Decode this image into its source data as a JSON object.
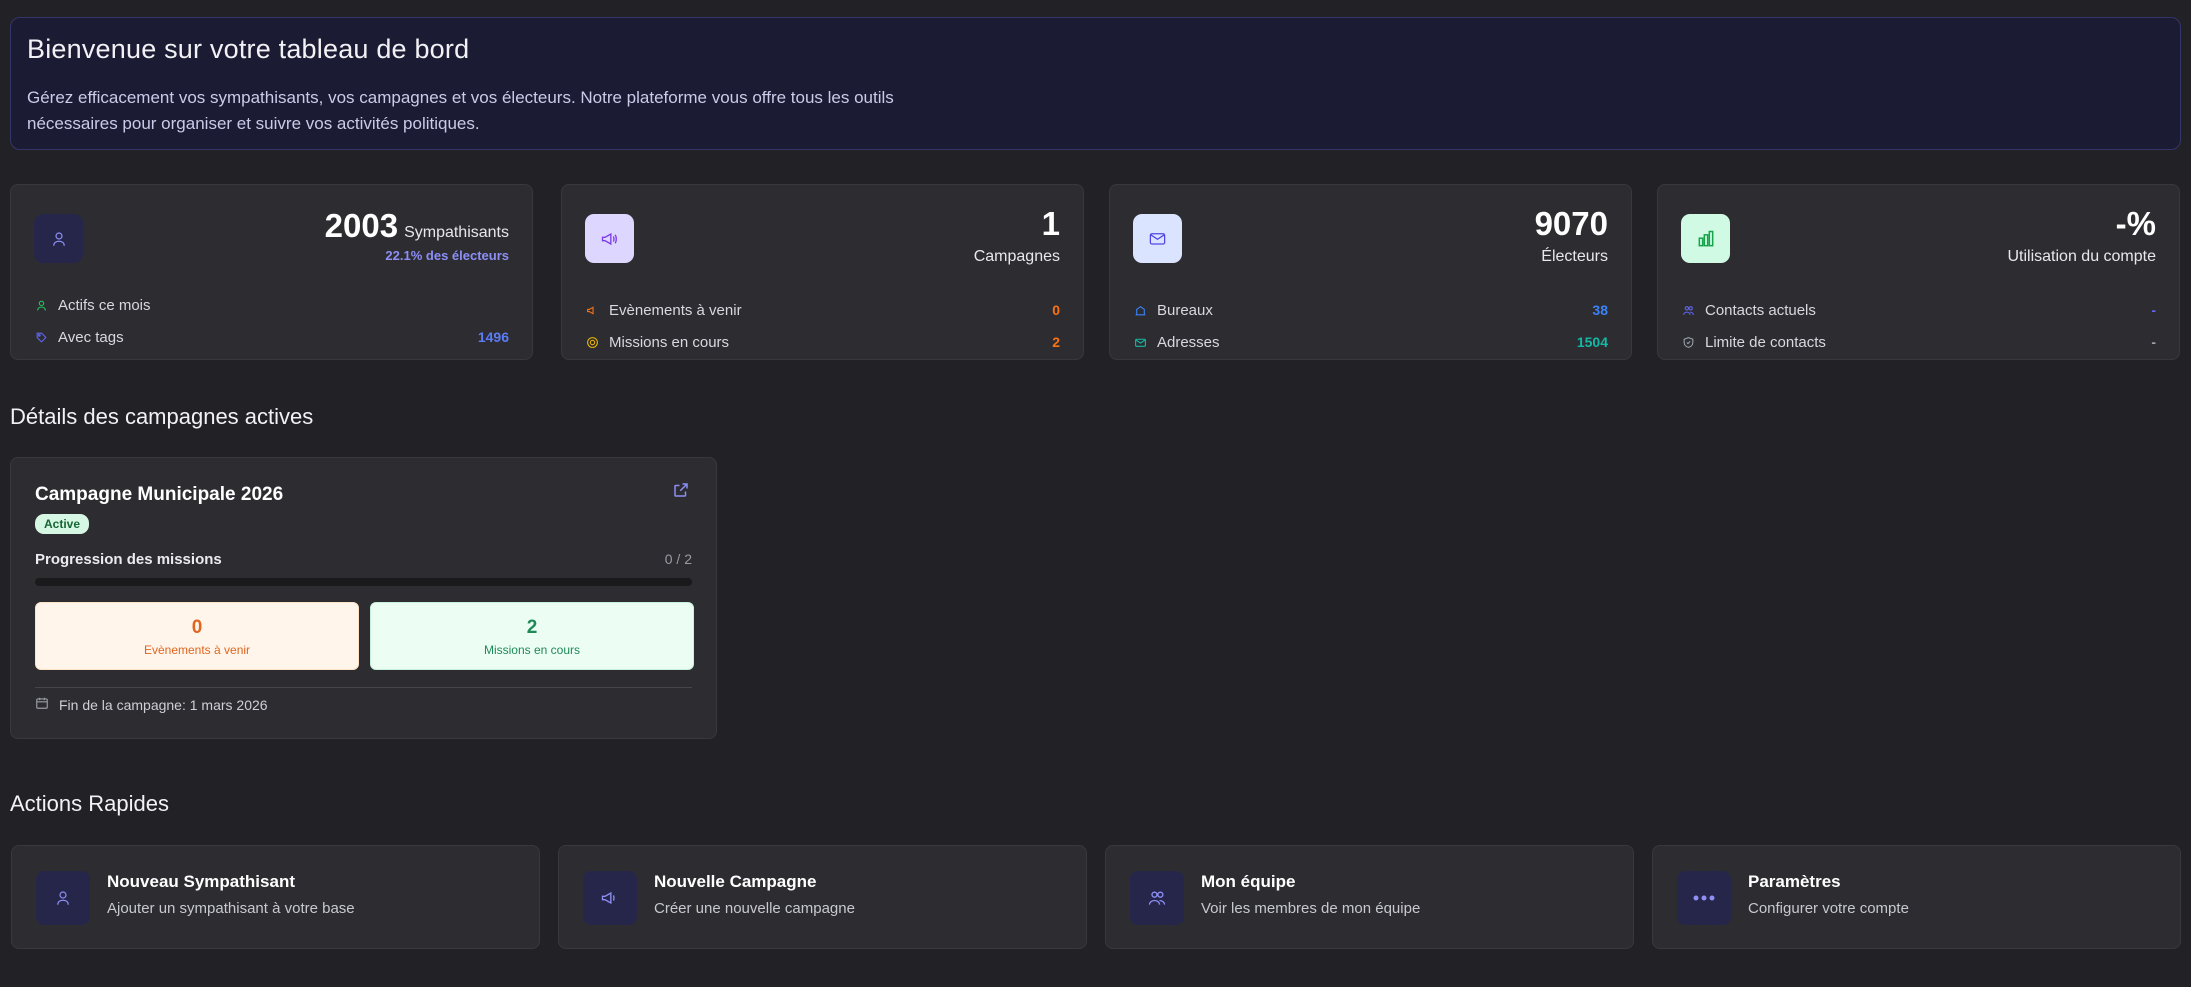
{
  "welcome": {
    "title": "Bienvenue sur votre tableau de bord",
    "text": "Gérez efficacement vos sympathisants, vos campagnes et vos électeurs. Notre plateforme vous offre tous les outils nécessaires pour organiser et suivre vos activités politiques."
  },
  "stats": {
    "sympathisants": {
      "value": "2003",
      "unit": "Sympathisants",
      "percent": "22.1% des électeurs",
      "icon": "user-icon",
      "rows": [
        {
          "label": "Actifs ce mois",
          "value": "",
          "icon": "user-icon"
        },
        {
          "label": "Avec tags",
          "value": "1496",
          "icon": "tag-icon"
        }
      ]
    },
    "campagnes": {
      "value": "1",
      "unit": "Campagnes",
      "icon": "megaphone-icon",
      "rows": [
        {
          "label": "Evènements à venir",
          "value": "0",
          "icon": "megaphone-icon"
        },
        {
          "label": "Missions en cours",
          "value": "2",
          "icon": "target-icon"
        }
      ]
    },
    "electeurs": {
      "value": "9070",
      "unit": "Électeurs",
      "icon": "mail-icon",
      "rows": [
        {
          "label": "Bureaux",
          "value": "38",
          "icon": "building-icon"
        },
        {
          "label": "Adresses",
          "value": "1504",
          "icon": "mail-icon"
        }
      ]
    },
    "compte": {
      "value": "-%",
      "unit": "Utilisation du compte",
      "icon": "bar-chart-icon",
      "rows": [
        {
          "label": "Contacts actuels",
          "value": "-",
          "icon": "users-icon"
        },
        {
          "label": "Limite de contacts",
          "value": "-",
          "icon": "shield-icon"
        }
      ]
    }
  },
  "campaigns_section": {
    "title": "Détails des campagnes actives",
    "card": {
      "name": "Campagne Municipale 2026",
      "status": "Active",
      "progress_label": "Progression des missions",
      "progress_count": "0 / 2",
      "progress_fraction": 0,
      "events": {
        "value": "0",
        "label": "Evènements à venir"
      },
      "missions": {
        "value": "2",
        "label": "Missions en cours"
      },
      "end": "Fin de la campagne: 1 mars 2026"
    }
  },
  "actions_section": {
    "title": "Actions Rapides",
    "items": [
      {
        "title": "Nouveau Sympathisant",
        "subtitle": "Ajouter un sympathisant à votre base",
        "icon": "user-icon"
      },
      {
        "title": "Nouvelle Campagne",
        "subtitle": "Créer une nouvelle campagne",
        "icon": "megaphone-icon"
      },
      {
        "title": "Mon équipe",
        "subtitle": "Voir les membres de mon équipe",
        "icon": "users-icon"
      },
      {
        "title": "Paramètres",
        "subtitle": "Configurer votre compte",
        "icon": "more-icon"
      }
    ]
  },
  "colors": {
    "accent": "#6366f1",
    "orange": "#f97316",
    "blue": "#3b82f6",
    "teal": "#14b8a6",
    "green": "#16a34a"
  }
}
